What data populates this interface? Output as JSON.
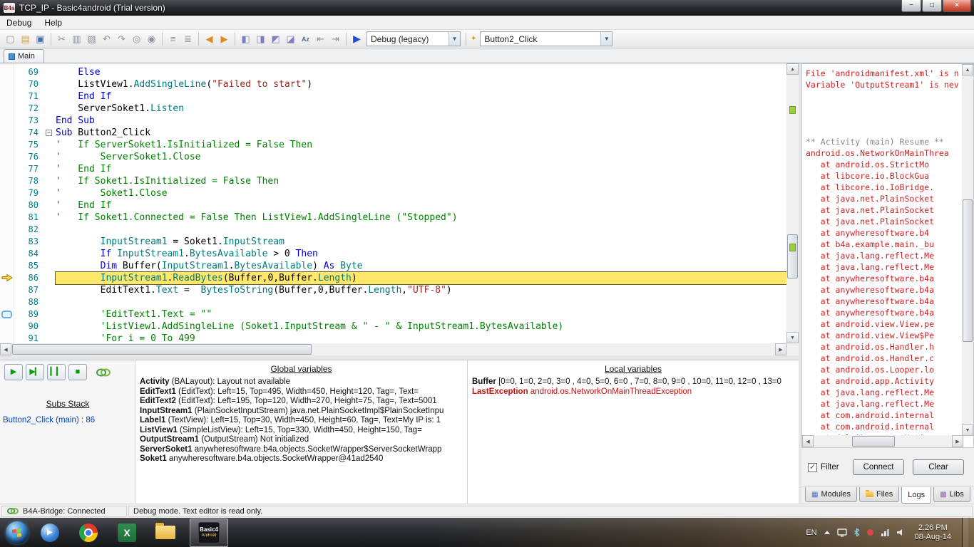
{
  "window": {
    "icon": "B4a",
    "title": "TCP_IP - Basic4android (Trial version)"
  },
  "menu": {
    "items": [
      "Debug",
      "Help"
    ]
  },
  "toolbar": {
    "debug_mode_value": "Debug (legacy)",
    "sub_selector_value": "Button2_Click"
  },
  "tabs": {
    "items": [
      "Main"
    ]
  },
  "editor": {
    "current_line": 86,
    "bookmark_line": 89,
    "collapse_line": 74,
    "lines": [
      {
        "n": 69,
        "t": [
          [
            "p",
            "    "
          ],
          [
            "k",
            "Else"
          ]
        ]
      },
      {
        "n": 70,
        "t": [
          [
            "p",
            "    ListView1."
          ],
          [
            "m",
            "AddSingleLine"
          ],
          [
            "p",
            "("
          ],
          [
            "s",
            "\"Failed to start\""
          ],
          [
            "p",
            ")"
          ]
        ]
      },
      {
        "n": 71,
        "t": [
          [
            "p",
            "    "
          ],
          [
            "k",
            "End If"
          ]
        ]
      },
      {
        "n": 72,
        "t": [
          [
            "p",
            "    ServerSoket1."
          ],
          [
            "m",
            "Listen"
          ]
        ]
      },
      {
        "n": 73,
        "t": [
          [
            "k",
            "End Sub"
          ]
        ]
      },
      {
        "n": 74,
        "t": [
          [
            "k",
            "Sub"
          ],
          [
            "p",
            " Button2_Click"
          ]
        ]
      },
      {
        "n": 75,
        "t": [
          [
            "c",
            "'   If ServerSoket1.IsInitialized = False Then"
          ]
        ]
      },
      {
        "n": 76,
        "t": [
          [
            "c",
            "'       ServerSoket1.Close"
          ]
        ]
      },
      {
        "n": 77,
        "t": [
          [
            "c",
            "'   End If"
          ]
        ]
      },
      {
        "n": 78,
        "t": [
          [
            "c",
            "'   If Soket1.IsInitialized = False Then"
          ]
        ]
      },
      {
        "n": 79,
        "t": [
          [
            "c",
            "'       Soket1.Close"
          ]
        ]
      },
      {
        "n": 80,
        "t": [
          [
            "c",
            "'   End If"
          ]
        ]
      },
      {
        "n": 81,
        "t": [
          [
            "c",
            "'   If Soket1.Connected = False Then ListView1.AddSingleLine (\"Stopped\")"
          ]
        ]
      },
      {
        "n": 82,
        "t": []
      },
      {
        "n": 83,
        "t": [
          [
            "p",
            "        "
          ],
          [
            "m",
            "InputStream1"
          ],
          [
            "p",
            " = Soket1."
          ],
          [
            "m",
            "InputStream"
          ]
        ]
      },
      {
        "n": 84,
        "t": [
          [
            "p",
            "        "
          ],
          [
            "k",
            "If"
          ],
          [
            "p",
            " "
          ],
          [
            "m",
            "InputStream1"
          ],
          [
            "p",
            "."
          ],
          [
            "m",
            "BytesAvailable"
          ],
          [
            "p",
            " > 0 "
          ],
          [
            "k",
            "Then"
          ]
        ]
      },
      {
        "n": 85,
        "t": [
          [
            "p",
            "        "
          ],
          [
            "k",
            "Dim"
          ],
          [
            "p",
            " Buffer("
          ],
          [
            "m",
            "InputStream1"
          ],
          [
            "p",
            "."
          ],
          [
            "m",
            "BytesAvailable"
          ],
          [
            "p",
            ") "
          ],
          [
            "k",
            "As"
          ],
          [
            "p",
            " "
          ],
          [
            "m",
            "Byte"
          ]
        ]
      },
      {
        "n": 86,
        "t": [
          [
            "p",
            "        "
          ],
          [
            "m",
            "InputStream1"
          ],
          [
            "p",
            "."
          ],
          [
            "m",
            "ReadBytes"
          ],
          [
            "p",
            "(Buffer,0,Buffer."
          ],
          [
            "m",
            "Length"
          ],
          [
            "p",
            ")"
          ]
        ]
      },
      {
        "n": 87,
        "t": [
          [
            "p",
            "        EditText1."
          ],
          [
            "m",
            "Text"
          ],
          [
            "p",
            " =  "
          ],
          [
            "m",
            "BytesToString"
          ],
          [
            "p",
            "(Buffer,0,Buffer."
          ],
          [
            "m",
            "Length"
          ],
          [
            "p",
            ","
          ],
          [
            "s",
            "\"UTF-8\""
          ],
          [
            "p",
            ")"
          ]
        ]
      },
      {
        "n": 88,
        "t": []
      },
      {
        "n": 89,
        "t": [
          [
            "p",
            "        "
          ],
          [
            "c",
            "'EditText1.Text = \"\""
          ]
        ]
      },
      {
        "n": 90,
        "t": [
          [
            "p",
            "        "
          ],
          [
            "c",
            "'ListView1.AddSingleLine (Soket1.InputStream & \" - \" & InputStream1.BytesAvailable)"
          ]
        ]
      },
      {
        "n": 91,
        "t": [
          [
            "p",
            "        "
          ],
          [
            "c",
            "'For i = 0 To 499"
          ]
        ]
      }
    ]
  },
  "logs": {
    "lines": [
      {
        "text": "File 'androidmanifest.xml' is n",
        "color": "red"
      },
      {
        "text": "Variable 'OutputStream1' is nev",
        "color": "red"
      },
      {
        "text": "",
        "color": "red"
      },
      {
        "text": "",
        "color": "red"
      },
      {
        "text": "",
        "color": "red"
      },
      {
        "text": "",
        "color": "red"
      },
      {
        "text": "** Activity (main) Resume **",
        "color": "gray"
      },
      {
        "text": "android.os.NetworkOnMainThrea",
        "color": "red"
      },
      {
        "text": "   at android.os.StrictMo",
        "color": "red"
      },
      {
        "text": "   at libcore.io.BlockGua",
        "color": "red"
      },
      {
        "text": "   at libcore.io.IoBridge.",
        "color": "red"
      },
      {
        "text": "   at java.net.PlainSocket",
        "color": "red"
      },
      {
        "text": "   at java.net.PlainSocket",
        "color": "red"
      },
      {
        "text": "   at java.net.PlainSocket",
        "color": "red"
      },
      {
        "text": "   at anywheresoftware.b4",
        "color": "red"
      },
      {
        "text": "   at b4a.example.main._bu",
        "color": "red"
      },
      {
        "text": "   at java.lang.reflect.Me",
        "color": "red"
      },
      {
        "text": "   at java.lang.reflect.Me",
        "color": "red"
      },
      {
        "text": "   at anywheresoftware.b4a",
        "color": "red"
      },
      {
        "text": "   at anywheresoftware.b4a",
        "color": "red"
      },
      {
        "text": "   at anywheresoftware.b4a",
        "color": "red"
      },
      {
        "text": "   at anywheresoftware.b4a",
        "color": "red"
      },
      {
        "text": "   at android.view.View.pe",
        "color": "red"
      },
      {
        "text": "   at android.view.View$Pe",
        "color": "red"
      },
      {
        "text": "   at android.os.Handler.h",
        "color": "red"
      },
      {
        "text": "   at android.os.Handler.c",
        "color": "red"
      },
      {
        "text": "   at android.os.Looper.lo",
        "color": "red"
      },
      {
        "text": "   at android.app.Activity",
        "color": "red"
      },
      {
        "text": "   at java.lang.reflect.Me",
        "color": "red"
      },
      {
        "text": "   at java.lang.reflect.Me",
        "color": "red"
      },
      {
        "text": "   at com.android.internal",
        "color": "red"
      },
      {
        "text": "   at com.android.internal",
        "color": "red"
      },
      {
        "text": "   at dalvik.system.Native",
        "color": "red"
      }
    ],
    "filter_label": "Filter",
    "connect_label": "Connect",
    "clear_label": "Clear",
    "tabs": [
      "Modules",
      "Files",
      "Logs",
      "Libs"
    ],
    "active_tab": "Logs"
  },
  "debug_panel": {
    "subs_stack_title": "Subs Stack",
    "subs_stack": [
      "Button2_Click (main) : 86"
    ],
    "globals_title": "Global variables",
    "globals": [
      {
        "name": "Activity",
        "value": " (BALayout): Layout not available"
      },
      {
        "name": "EditText1",
        "value": " (EditText): Left=15, Top=495, Width=450, Height=120, Tag=, Text="
      },
      {
        "name": "EditText2",
        "value": " (EditText): Left=195, Top=120, Width=270, Height=75, Tag=, Text=5001"
      },
      {
        "name": "InputStream1",
        "value": " (PlainSocketInputStream) java.net.PlainSocketImpl$PlainSocketInpu"
      },
      {
        "name": "Label1",
        "value": " (TextView): Left=15, Top=30, Width=450, Height=60, Tag=, Text=My IP is: 1"
      },
      {
        "name": "ListView1",
        "value": " (SimpleListView): Left=15, Top=330, Width=450, Height=150, Tag="
      },
      {
        "name": "OutputStream1",
        "value": " (OutputStream) Not initialized"
      },
      {
        "name": "ServerSoket1",
        "value": " anywheresoftware.b4a.objects.SocketWrapper$ServerSocketWrapp"
      },
      {
        "name": "Soket1",
        "value": " anywheresoftware.b4a.objects.SocketWrapper@41ad2540"
      }
    ],
    "locals_title": "Local variables",
    "locals": [
      {
        "name": "Buffer",
        "value": " [0=0, 1=0, 2=0, 3=0 , 4=0, 5=0, 6=0 , 7=0, 8=0, 9=0 , 10=0, 11=0, 12=0 , 13=0",
        "red": false
      },
      {
        "name": "LastException",
        "value": " android.os.NetworkOnMainThreadException",
        "red": true
      }
    ]
  },
  "statusbar": {
    "bridge": "B4A-Bridge: Connected",
    "mode": "Debug mode. Text editor is read only."
  },
  "taskbar": {
    "language": "EN",
    "time": "2:26 PM",
    "date": "08-Aug-14",
    "b4a_label_top": "Basic4",
    "b4a_label_bottom": "Android"
  },
  "colors": {
    "keyword": "#0000d4",
    "member": "#00797d",
    "string": "#a0251f",
    "comment": "#008000",
    "log_error": "#cc2222",
    "highlight": "#ffe76b",
    "line_number": "#007c86",
    "link": "#0040c0",
    "status_green": "#3f9e3f"
  }
}
